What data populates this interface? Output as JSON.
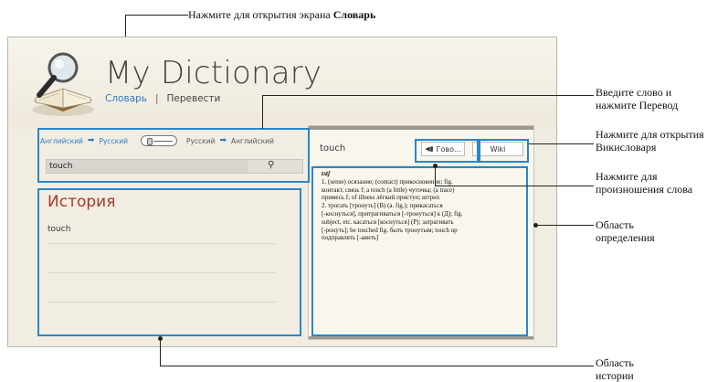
{
  "app": {
    "title": "My Dictionary",
    "nav": {
      "dictionary": "Словарь",
      "separator": "|",
      "translate": "Перевести"
    }
  },
  "search": {
    "from_lang": "Английский",
    "to_lang": "Русский",
    "alt_from_lang": "Русский",
    "alt_to_lang": "Английский",
    "query": "touch"
  },
  "history": {
    "title": "История",
    "items": [
      "touch"
    ]
  },
  "definition": {
    "word": "touch",
    "pronounce_label": "Гово...",
    "wiki_label": "Wiki",
    "transcription": "tʌtʃ",
    "lines": [
      "1. (sense) осязание; (contact) прикосновение; fig.",
      "контакт, связь f; a touch (a little) чуточка; (a trace)",
      "примесь f; of illness лёгкий приступ; штрих",
      "2. трогать [тронуть] (В) (a. fig.); прикасаться",
      "[-коснуться], притрагиваться [-тронуться] к (Д); fig.",
      "subject, etc. касаться [коснуться] (Р); затрагивать",
      "[-ронуть]; be touched fig. быть тронутым; touch up",
      "подправлять [-авить]"
    ]
  },
  "callouts": {
    "dictionary": {
      "text": "Нажмите для открытия экрана ",
      "bold": "Словарь"
    },
    "search": [
      "Введите слово и",
      "нажмите Перевод"
    ],
    "wiki": [
      "Нажмите для открытия",
      "Викисловаря"
    ],
    "pronounce": [
      "Нажмите для",
      "произношения слова"
    ],
    "definition": [
      "Область",
      "определения"
    ],
    "history": [
      "Область",
      "истории"
    ]
  },
  "colors": {
    "accent": "#2e7bc9",
    "history_title": "#a43a2a",
    "callout_box": "#2a86c8"
  }
}
